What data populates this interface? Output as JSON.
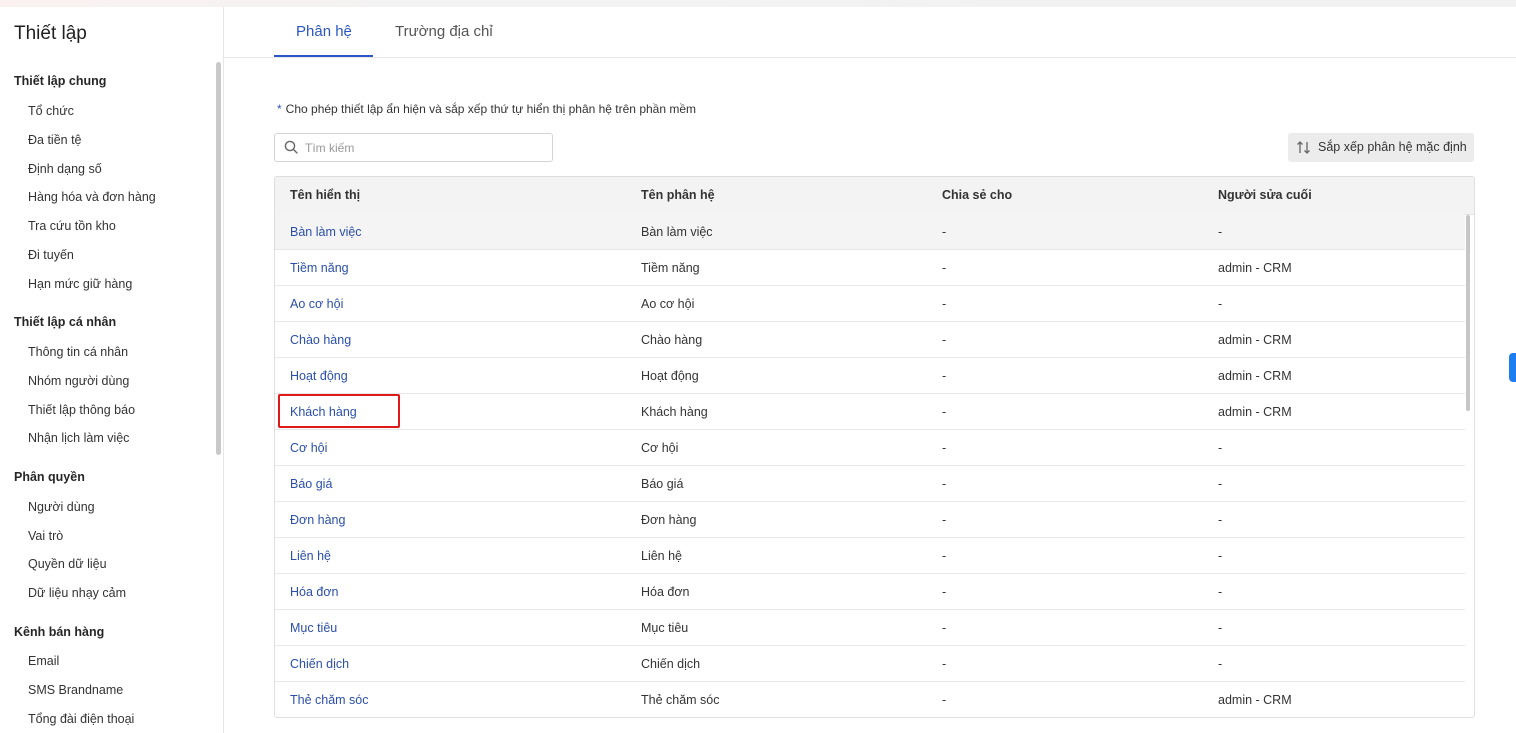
{
  "sidebar": {
    "title": "Thiết lập",
    "groups": [
      {
        "label": "Thiết lập chung",
        "items": [
          "Tổ chức",
          "Đa tiền tệ",
          "Định dạng số",
          "Hàng hóa và đơn hàng",
          "Tra cứu tồn kho",
          "Đi tuyến",
          "Hạn mức giữ hàng"
        ]
      },
      {
        "label": "Thiết lập cá nhân",
        "items": [
          "Thông tin cá nhân",
          "Nhóm người dùng",
          "Thiết lập thông báo",
          "Nhận lịch làm việc"
        ]
      },
      {
        "label": "Phân quyền",
        "items": [
          "Người dùng",
          "Vai trò",
          "Quyền dữ liệu",
          "Dữ liệu nhạy cảm"
        ]
      },
      {
        "label": "Kênh bán hàng",
        "items": [
          "Email",
          "SMS Brandname",
          "Tổng đài điện thoại"
        ]
      }
    ]
  },
  "tabs": [
    {
      "label": "Phân hệ",
      "active": true
    },
    {
      "label": "Trường địa chỉ",
      "active": false
    }
  ],
  "note": {
    "star": "*",
    "text": "Cho phép thiết lập ẩn hiện và sắp xếp thứ tự hiển thị phân hệ trên phần mềm"
  },
  "search": {
    "placeholder": "Tìm kiếm",
    "value": ""
  },
  "sort_button": {
    "label": "Sắp xếp phân hệ mặc định"
  },
  "table": {
    "headers": [
      "Tên hiển thị",
      "Tên phân hệ",
      "Chia sẻ cho",
      "Người sửa cuối"
    ],
    "rows": [
      {
        "display": "Bàn làm việc",
        "module": "Bàn làm việc",
        "shared": "-",
        "editor": "-"
      },
      {
        "display": "Tiềm năng",
        "module": "Tiềm năng",
        "shared": "-",
        "editor": "admin - CRM"
      },
      {
        "display": "Ao cơ hội",
        "module": "Ao cơ hội",
        "shared": "-",
        "editor": "-"
      },
      {
        "display": "Chào hàng",
        "module": "Chào hàng",
        "shared": "-",
        "editor": "admin - CRM"
      },
      {
        "display": "Hoạt động",
        "module": "Hoạt động",
        "shared": "-",
        "editor": "admin - CRM"
      },
      {
        "display": "Khách hàng",
        "module": "Khách hàng",
        "shared": "-",
        "editor": "admin - CRM"
      },
      {
        "display": "Cơ hội",
        "module": "Cơ hội",
        "shared": "-",
        "editor": "-"
      },
      {
        "display": "Báo giá",
        "module": "Báo giá",
        "shared": "-",
        "editor": "-"
      },
      {
        "display": "Đơn hàng",
        "module": "Đơn hàng",
        "shared": "-",
        "editor": "-"
      },
      {
        "display": "Liên hệ",
        "module": "Liên hệ",
        "shared": "-",
        "editor": "-"
      },
      {
        "display": "Hóa đơn",
        "module": "Hóa đơn",
        "shared": "-",
        "editor": "-"
      },
      {
        "display": "Mục tiêu",
        "module": "Mục tiêu",
        "shared": "-",
        "editor": "-"
      },
      {
        "display": "Chiến dịch",
        "module": "Chiến dịch",
        "shared": "-",
        "editor": "-"
      },
      {
        "display": "Thẻ chăm sóc",
        "module": "Thẻ chăm sóc",
        "shared": "-",
        "editor": "admin - CRM"
      }
    ]
  },
  "colors": {
    "accent": "#2b56c5",
    "link": "#2b4fa8",
    "highlight_border": "#e01919"
  }
}
